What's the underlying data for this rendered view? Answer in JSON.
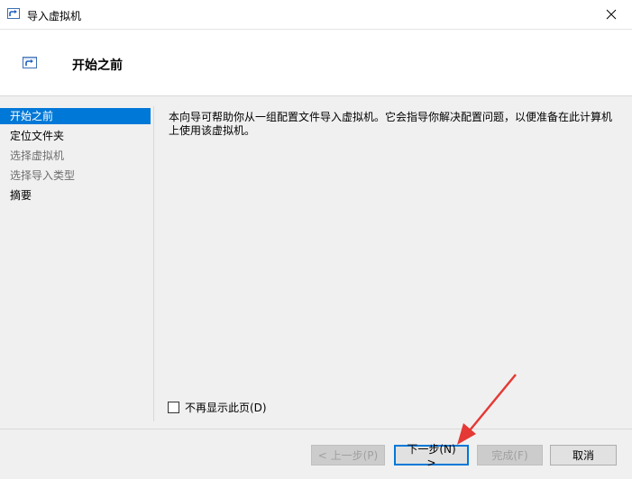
{
  "window": {
    "title": "导入虚拟机"
  },
  "header": {
    "page_title": "开始之前"
  },
  "sidebar": {
    "items": [
      {
        "label": "开始之前",
        "state": "active"
      },
      {
        "label": "定位文件夹",
        "state": "enabled"
      },
      {
        "label": "选择虚拟机",
        "state": "disabled"
      },
      {
        "label": "选择导入类型",
        "state": "disabled"
      },
      {
        "label": "摘要",
        "state": "enabled"
      }
    ]
  },
  "main": {
    "description": "本向导可帮助你从一组配置文件导入虚拟机。它会指导你解决配置问题，以便准备在此计算机上使用该虚拟机。",
    "dont_show_label": "不再显示此页(D)",
    "dont_show_checked": false
  },
  "buttons": {
    "previous": "< 上一步(P)",
    "next": "下一步(N) >",
    "finish": "完成(F)",
    "cancel": "取消"
  },
  "colors": {
    "accent": "#0078d7",
    "annotation_arrow": "#e53935"
  },
  "icons": {
    "app": "import-vm-icon",
    "close": "close-icon",
    "wizard": "import-vm-icon"
  }
}
